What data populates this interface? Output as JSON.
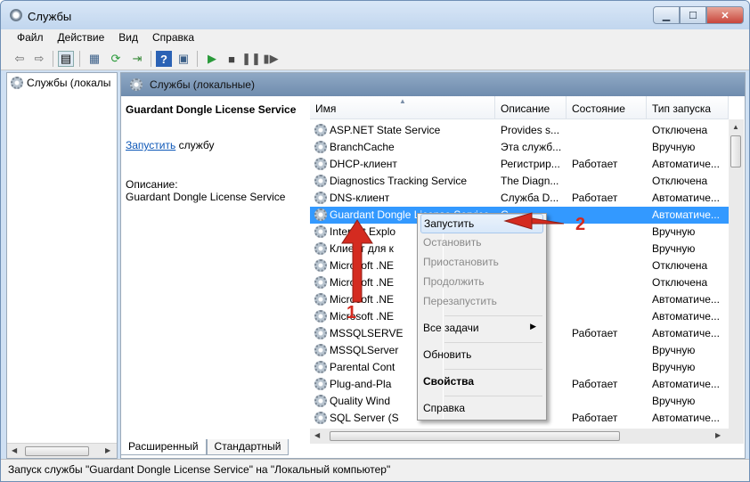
{
  "window": {
    "title": "Службы"
  },
  "menu": [
    "Файл",
    "Действие",
    "Вид",
    "Справка"
  ],
  "tree": {
    "item": "Службы (локалы"
  },
  "panel": {
    "header": "Службы (локальные)",
    "selected_service": "Guardant Dongle License Service",
    "start_link": "Запустить",
    "start_suffix": " службу",
    "description_label": "Описание:",
    "description_text": "Guardant Dongle License Service"
  },
  "columns": [
    "Имя",
    "Описание",
    "Состояние",
    "Тип запуска"
  ],
  "services": [
    {
      "name": "ASP.NET State Service",
      "desc": "Provides s...",
      "state": "",
      "startup": "Отключена"
    },
    {
      "name": "BranchCache",
      "desc": "Эта служб...",
      "state": "",
      "startup": "Вручную"
    },
    {
      "name": "DHCP-клиент",
      "desc": "Регистрир...",
      "state": "Работает",
      "startup": "Автоматиче..."
    },
    {
      "name": "Diagnostics Tracking Service",
      "desc": "The Diagn...",
      "state": "",
      "startup": "Отключена"
    },
    {
      "name": "DNS-клиент",
      "desc": "Служба D...",
      "state": "Работает",
      "startup": "Автоматиче..."
    },
    {
      "name": "Guardant Dongle License Service",
      "desc": "G...",
      "state": "",
      "startup": "Автоматиче...",
      "selected": true
    },
    {
      "name": "Internet Explo",
      "desc": "",
      "state": "",
      "startup": "Вручную"
    },
    {
      "name": "Клиент для к",
      "desc": "",
      "state": "",
      "startup": "Вручную"
    },
    {
      "name": "Microsoft .NE",
      "desc": "",
      "state": "",
      "startup": "Отключена"
    },
    {
      "name": "Microsoft .NE",
      "desc": "",
      "state": "",
      "startup": "Отключена"
    },
    {
      "name": "Microsoft .NE",
      "desc": "",
      "state": "",
      "startup": "Автоматиче..."
    },
    {
      "name": "Microsoft .NE",
      "desc": "",
      "state": "",
      "startup": "Автоматиче..."
    },
    {
      "name": "MSSQLSERVE",
      "desc": "",
      "state": "Работает",
      "startup": "Автоматиче..."
    },
    {
      "name": "MSSQLServer",
      "desc": "",
      "state": "",
      "startup": "Вручную"
    },
    {
      "name": "Parental Cont",
      "desc": "",
      "state": "",
      "startup": "Вручную"
    },
    {
      "name": "Plug-and-Pla",
      "desc": "",
      "state": "Работает",
      "startup": "Автоматиче..."
    },
    {
      "name": "Quality Wind",
      "desc": "",
      "state": "",
      "startup": "Вручную"
    },
    {
      "name": "SQL Server (S",
      "desc": "",
      "state": "Работает",
      "startup": "Автоматиче..."
    }
  ],
  "context_menu": {
    "start": "Запустить",
    "stop": "Остановить",
    "pause": "Приостановить",
    "resume": "Продолжить",
    "restart": "Перезапустить",
    "all_tasks": "Все задачи",
    "refresh": "Обновить",
    "properties": "Свойства",
    "help": "Справка"
  },
  "tabs": [
    "Расширенный",
    "Стандартный"
  ],
  "status": "Запуск службы \"Guardant Dongle License Service\" на \"Локальный компьютер\"",
  "annotations": {
    "step1": "1",
    "step2": "2",
    "color": "#d42b20"
  }
}
